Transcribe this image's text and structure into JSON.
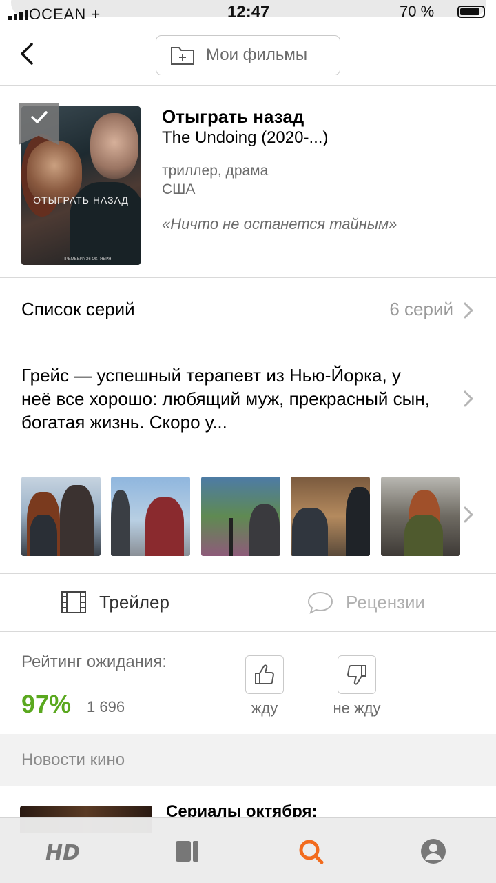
{
  "status_bar": {
    "carrier": "OCEAN +",
    "time": "12:47",
    "battery": "70 %"
  },
  "header": {
    "back_icon": "chevron-left-icon",
    "my_films_icon": "folder-plus-icon",
    "my_films_label": "Мои фильмы"
  },
  "movie": {
    "poster_title": "ОТЫГРАТЬ НАЗАД",
    "poster_credits": "ПРЕМЬЕРА 26 ОКТЯБРЯ",
    "title": "Отыграть назад",
    "original_title": "The Undoing (2020-...)",
    "genres": "триллер, драма",
    "country": "США",
    "tagline": "«Ничто не останется тайным»",
    "watched_icon": "checkmark-bookmark-icon"
  },
  "episodes": {
    "label": "Список серий",
    "count": "6 серий"
  },
  "description": {
    "text": "Грейс — успешный терапевт из Нью-Йорка, у неё все хорошо: любящий муж, прекрасный сын, богатая жизнь. Скоро у..."
  },
  "stills": {
    "count_visible": 5
  },
  "actions": {
    "trailer_label": "Трейлер",
    "reviews_label": "Рецензии"
  },
  "rating": {
    "label": "Рейтинг ожидания:",
    "percent": "97%",
    "votes": "1 696",
    "want_label": "жду",
    "not_want_label": "не жду",
    "accent_color": "#5aa81f"
  },
  "news": {
    "section_label": "Новости кино",
    "first_title": "Сериалы октября:"
  },
  "tabbar": {
    "active_color": "#f26b1d",
    "items": [
      "hd-icon",
      "book-icon",
      "search-icon",
      "profile-icon"
    ]
  }
}
